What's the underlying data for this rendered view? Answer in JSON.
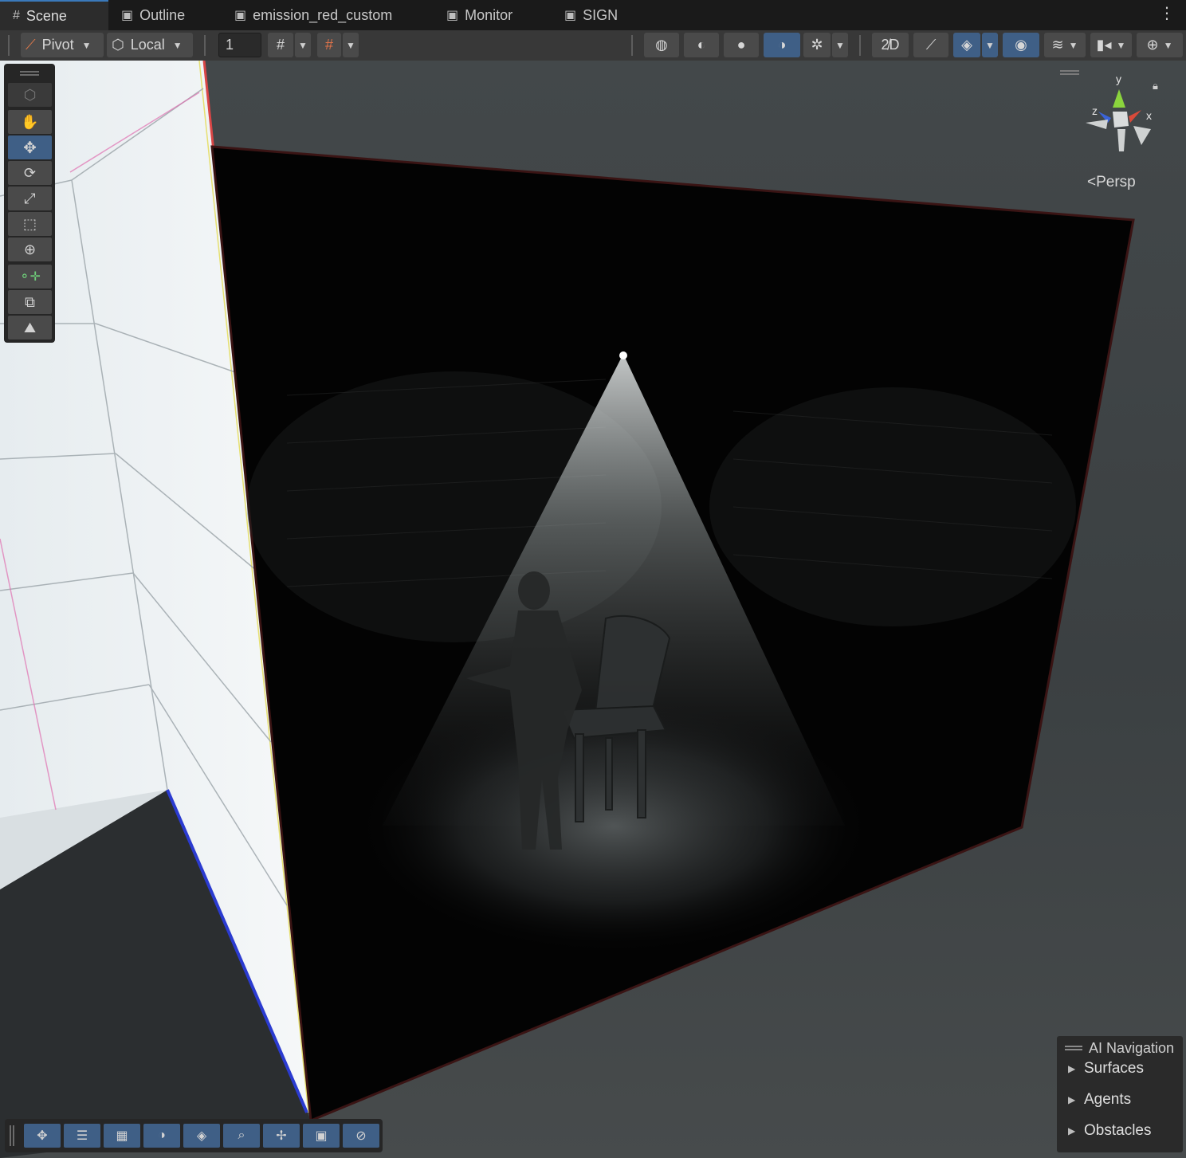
{
  "tabs": [
    {
      "label": "Scene",
      "icon": "grid-icon"
    },
    {
      "label": "Outline",
      "icon": "lock-tab-icon"
    },
    {
      "label": "emission_red_custom",
      "icon": "lock-tab-icon"
    },
    {
      "label": "Monitor",
      "icon": "lock-tab-icon"
    },
    {
      "label": "SIGN",
      "icon": "lock-tab-icon"
    }
  ],
  "toolbar": {
    "pivot_label": "Pivot",
    "local_label": "Local",
    "grid_size_value": "1"
  },
  "viewport": {
    "projection_label": "Persp",
    "gizmo_axes": {
      "y": "y",
      "x": "x",
      "z": "z"
    },
    "accent_color": "#3f5f86"
  },
  "ai_navigation": {
    "title": "AI Navigation",
    "items": [
      "Surfaces",
      "Agents",
      "Obstacles"
    ]
  }
}
